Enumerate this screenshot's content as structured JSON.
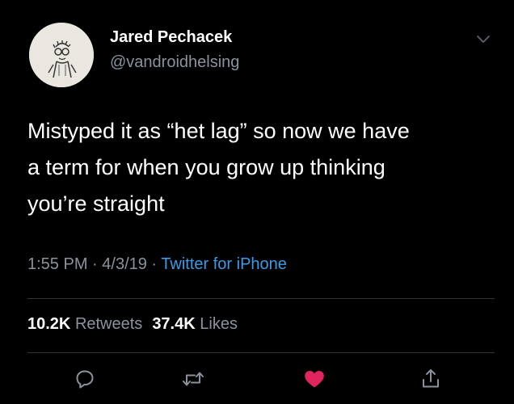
{
  "tweet": {
    "author": {
      "display_name": "Jared Pechacek",
      "handle": "@vandroidhelsing"
    },
    "text": "Mistyped it as “het lag” so now we have\na term for when you grow up thinking\nyou’re straight",
    "meta": {
      "time": "1:55 PM",
      "sep1": " · ",
      "date": "4/3/19",
      "sep2": " · ",
      "source": "Twitter for iPhone"
    },
    "stats": {
      "retweets_count": "10.2K",
      "retweets_label": "Retweets",
      "likes_count": "37.4K",
      "likes_label": "Likes"
    },
    "actions": {
      "reply_icon": "reply-icon",
      "retweet_icon": "retweet-icon",
      "like_icon": "heart-icon",
      "share_icon": "share-icon"
    }
  },
  "colors": {
    "background": "#000000",
    "text": "#ffffff",
    "secondary": "#8a939b",
    "link": "#3a9be8",
    "like": "#e0245e",
    "divider": "#2f3336"
  }
}
